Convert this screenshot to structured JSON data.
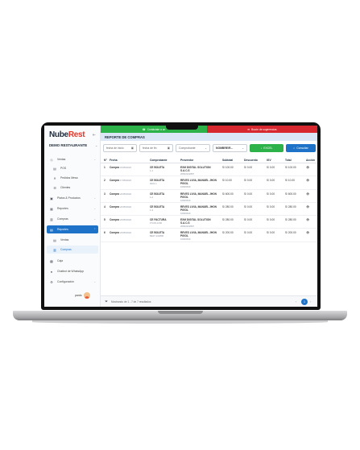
{
  "banners": {
    "left_icon": "headset-icon",
    "left_text": "Contáctate a un",
    "right_icon": "megaphone-icon",
    "right_text": "Buzón de sugerencias"
  },
  "brand": {
    "part1": "Nube",
    "part2": "Rest",
    "restaurant": "DEMO RESTAURANTE"
  },
  "sidebar": {
    "items": [
      {
        "label": "Ventas",
        "icon": "tag-icon"
      },
      {
        "label": "POS",
        "icon": "register-icon"
      },
      {
        "label": "Pedidos Mesa",
        "icon": "utensils-icon"
      },
      {
        "label": "Clientes",
        "icon": "users-icon"
      },
      {
        "label": "Platos & Productos",
        "icon": "box-icon"
      },
      {
        "label": "Reportes",
        "icon": "chart-icon"
      },
      {
        "label": "Compras",
        "icon": "cart-icon"
      },
      {
        "label": "Reportes",
        "icon": "report-icon"
      },
      {
        "label": "Ventas",
        "icon": "list-icon"
      },
      {
        "label": "Compras",
        "icon": "cart-icon"
      },
      {
        "label": "Caja",
        "icon": "cash-icon"
      },
      {
        "label": "Chatbot de WhatsApp",
        "icon": "chat-icon"
      },
      {
        "label": "Configuración",
        "icon": "gear-icon"
      }
    ],
    "user": "pardo"
  },
  "main": {
    "title": "REPORTE DE COMPRAS",
    "filters": {
      "date_from": "fecha de inicio",
      "date_to": "fecha de fin",
      "voucher": "Comprobante",
      "name": "NOMBRE/R...",
      "excel_label": "EXCEL",
      "search_label": "Consultar"
    },
    "columns": [
      "N°",
      "Fecha",
      "Comprobante",
      "Proveedor",
      "Subtotal",
      "Descuento",
      "IGV",
      "Total",
      "Acción"
    ],
    "rows": [
      {
        "n": "1",
        "fecha": "Compra",
        "fecha_sub": "15/05/2023",
        "comp": "CE BOLETA",
        "comp_sub": "1-1",
        "prov": "EXM DIGITAL SOLUTION S.A.C.S",
        "prov_sub": "20602222897",
        "subtotal": "S/ 100.00",
        "desc": "S/ 0.00",
        "igv": "S/ 0.00",
        "total": "S/ 100.00",
        "accion": "👁"
      },
      {
        "n": "2",
        "fecha": "Compra",
        "fecha_sub": "17/05/2023",
        "comp": "CE BOLETA",
        "comp_sub": "0001-1",
        "prov": "REVES LIVIA, MANUEL JHON PIGOL",
        "prov_sub": "10606630",
        "subtotal": "S/ 10.00",
        "desc": "S/ 0.00",
        "igv": "S/ 0.00",
        "total": "S/ 10.00",
        "accion": "👁"
      },
      {
        "n": "3",
        "fecha": "Compra",
        "fecha_sub": "22/05/2023",
        "comp": "CE BOLETA",
        "comp_sub": "1-2",
        "prov": "REVES LIVIA, MANUEL JHON PIGOL",
        "prov_sub": "10606630",
        "subtotal": "S/ 600.00",
        "desc": "S/ 0.00",
        "igv": "S/ 0.00",
        "total": "S/ 600.00",
        "accion": "👁"
      },
      {
        "n": "4",
        "fecha": "Compra",
        "fecha_sub": "22/05/2023",
        "comp": "CE BOLETA",
        "comp_sub": "1-3",
        "prov": "REVES LIVIA, MANUEL JHON PIGOL",
        "prov_sub": "10606630",
        "subtotal": "S/ 280.00",
        "desc": "S/ 0.00",
        "igv": "S/ 0.00",
        "total": "S/ 280.00",
        "accion": "👁"
      },
      {
        "n": "5",
        "fecha": "Compra",
        "fecha_sub": "23/05/2023",
        "comp": "CE FACTURA",
        "comp_sub": "F7233-1230",
        "prov": "EXM DIGITAL SOLUTION S.A.C.S",
        "prov_sub": "20602222897",
        "subtotal": "S/ 280.00",
        "desc": "S/ 0.00",
        "igv": "S/ 0.00",
        "total": "S/ 280.00",
        "accion": "👁"
      },
      {
        "n": "6",
        "fecha": "Compra",
        "fecha_sub": "23/05/2023",
        "comp": "CE BOLETA",
        "comp_sub": "BE07-102890",
        "prov": "REVES LIVIA, MANUEL JHON PIGOL",
        "prov_sub": "10606630",
        "subtotal": "S/ 200.00",
        "desc": "S/ 0.00",
        "igv": "S/ 0.00",
        "total": "S/ 200.00",
        "accion": "👁"
      }
    ],
    "footer": {
      "text": "Mostrando de 1 - 7 de 7 resultados",
      "page": "1",
      "prev": "‹",
      "next": "›"
    }
  }
}
